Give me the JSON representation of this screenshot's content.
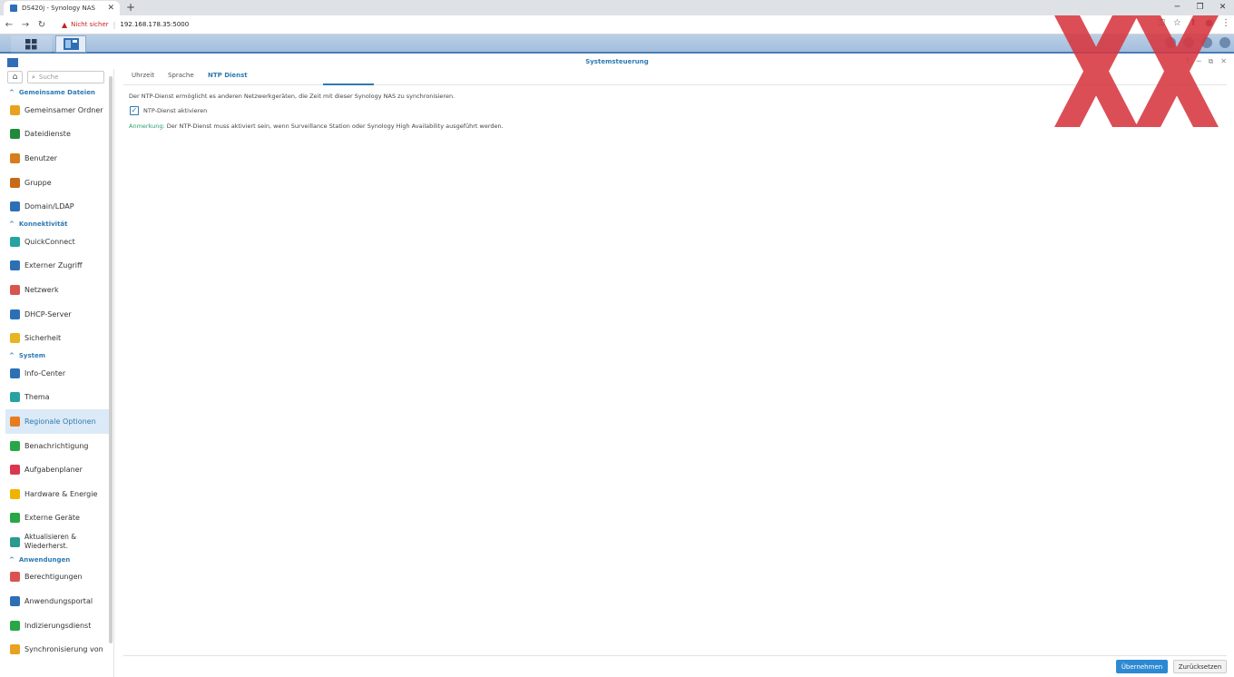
{
  "browser": {
    "tab_title": "DS420j - Synology NAS",
    "url_warning": "Nicht sicher",
    "url": "192.168.178.35:5000"
  },
  "window": {
    "title": "Systemsteuerung"
  },
  "search": {
    "placeholder": "Suche"
  },
  "sidebar": {
    "sections": [
      {
        "title": "Gemeinsame Dateien",
        "items": [
          {
            "label": "Gemeinsamer Ordner",
            "icon": "shared-folder-icon",
            "color": "#e8a21f"
          },
          {
            "label": "Dateidienste",
            "icon": "file-services-icon",
            "color": "#1f8a3a"
          },
          {
            "label": "Benutzer",
            "icon": "user-icon",
            "color": "#d67d1c"
          },
          {
            "label": "Gruppe",
            "icon": "group-icon",
            "color": "#c66a17"
          },
          {
            "label": "Domain/LDAP",
            "icon": "domain-icon",
            "color": "#2d6fb5"
          }
        ]
      },
      {
        "title": "Konnektivität",
        "items": [
          {
            "label": "QuickConnect",
            "icon": "quickconnect-icon",
            "color": "#26a3a0"
          },
          {
            "label": "Externer Zugriff",
            "icon": "globe-icon",
            "color": "#2d6fb5"
          },
          {
            "label": "Netzwerk",
            "icon": "network-icon",
            "color": "#d9534f"
          },
          {
            "label": "DHCP-Server",
            "icon": "dhcp-icon",
            "color": "#2d6fb5"
          },
          {
            "label": "Sicherheit",
            "icon": "shield-icon",
            "color": "#e8b41f"
          }
        ]
      },
      {
        "title": "System",
        "items": [
          {
            "label": "Info-Center",
            "icon": "info-icon",
            "color": "#2d6fb5"
          },
          {
            "label": "Thema",
            "icon": "theme-icon",
            "color": "#26a3a0"
          },
          {
            "label": "Regionale Optionen",
            "icon": "clock-globe-icon",
            "color": "#e87b1f",
            "selected": true
          },
          {
            "label": "Benachrichtigung",
            "icon": "chat-icon",
            "color": "#27a745"
          },
          {
            "label": "Aufgabenplaner",
            "icon": "calendar-check-icon",
            "color": "#d9364f"
          },
          {
            "label": "Hardware & Energie",
            "icon": "bulb-icon",
            "color": "#f0b400"
          },
          {
            "label": "Externe Geräte",
            "icon": "external-device-icon",
            "color": "#27a745"
          },
          {
            "label": "Aktualisieren & Wiederherst.",
            "icon": "refresh-icon",
            "color": "#2b9a8f"
          }
        ]
      },
      {
        "title": "Anwendungen",
        "items": [
          {
            "label": "Berechtigungen",
            "icon": "permissions-icon",
            "color": "#d9534f"
          },
          {
            "label": "Anwendungsportal",
            "icon": "portal-icon",
            "color": "#2d6fb5"
          },
          {
            "label": "Indizierungsdienst",
            "icon": "indexing-icon",
            "color": "#27a745"
          },
          {
            "label": "Synchronisierung von",
            "icon": "sync-icon",
            "color": "#e8a21f"
          }
        ]
      }
    ]
  },
  "tabs": [
    {
      "label": "Uhrzeit"
    },
    {
      "label": "Sprache"
    },
    {
      "label": "NTP Dienst",
      "active": true
    }
  ],
  "content": {
    "description": "Der NTP-Dienst ermöglicht es anderen Netzwerkgeräten, die Zeit mit dieser Synology NAS zu synchronisieren.",
    "checkbox_label": "NTP-Dienst aktivieren",
    "checkbox_checked": true,
    "note_label": "Anmerkung:",
    "note_text": " Der NTP-Dienst muss aktiviert sein, wenn Surveillance Station oder Synology High Availability ausgeführt werden."
  },
  "buttons": {
    "apply": "Übernehmen",
    "reset": "Zurücksetzen"
  },
  "colors": {
    "accent": "#2d7ab5",
    "watermark": "#d8363f"
  }
}
